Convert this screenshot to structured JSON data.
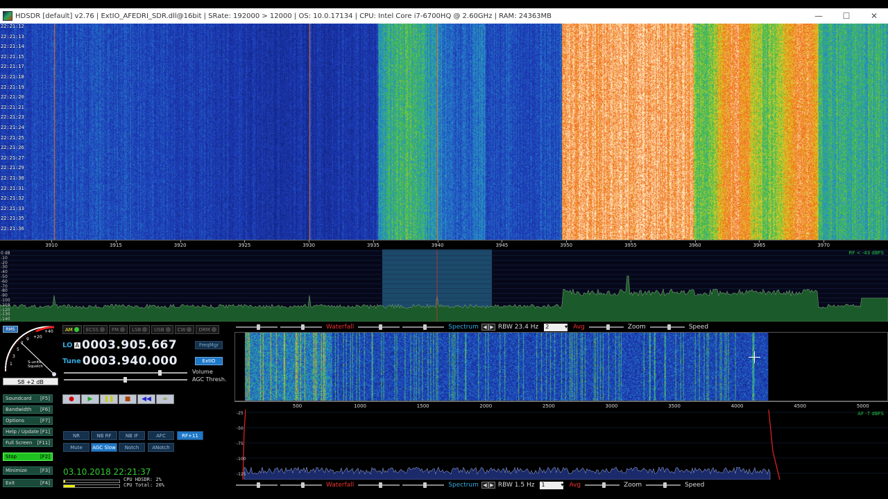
{
  "window": {
    "title": "HDSDR  [default]  v2.76  |  ExtIO_AFEDRI_SDR.dll@16bit  |  SRate: 192000 > 12000  |  OS: 10.0.17134  |  CPU: Intel Core i7-6700HQ @ 2.60GHz  |  RAM: 24363MB",
    "buttons": {
      "minimize": "—",
      "maximize": "☐",
      "close": "✕"
    }
  },
  "waterfall_times": [
    "22:21:12",
    "22:21:13",
    "22:21:14",
    "22:21:15",
    "22:21:17",
    "22:21:18",
    "22:21:19",
    "22:21:20",
    "22:21:21",
    "22:21:23",
    "22:21:24",
    "22:21:25",
    "22:21:26",
    "22:21:27",
    "22:21:29",
    "22:21:30",
    "22:21:31",
    "22:21:32",
    "22:21:33",
    "22:21:35",
    "22:21:36"
  ],
  "rf_axis": {
    "ticks": [
      "3910",
      "3915",
      "3920",
      "3925",
      "3930",
      "3935",
      "3940",
      "3945",
      "3950",
      "3955",
      "3960",
      "3965",
      "3970"
    ],
    "min": 3906,
    "max": 3975
  },
  "rf_db_labels": [
    "0 dB",
    "-10",
    "-20",
    "-30",
    "-40",
    "-50",
    "-60",
    "-70",
    "-80",
    "-90",
    "-100",
    "-110",
    "-120",
    "-130",
    "-140"
  ],
  "rf_level": "RF < -43 dBFS",
  "af_level": "AF -7 dBFS",
  "top_controls": {
    "waterfall": "Waterfall",
    "spectrum": "Spectrum",
    "rbw": "RBW 23.4 Hz",
    "avg_value": "2",
    "avg": "Avg",
    "zoom": "Zoom",
    "speed": "Speed"
  },
  "bottom_controls": {
    "waterfall": "Waterfall",
    "spectrum": "Spectrum",
    "rbw": "RBW  1.5 Hz",
    "avg_value": "1",
    "avg": "Avg",
    "zoom": "Zoom",
    "speed": "Speed"
  },
  "af_axis": {
    "ticks": [
      "500",
      "1000",
      "1500",
      "2000",
      "2500",
      "3000",
      "3500",
      "4000",
      "4500",
      "5000"
    ],
    "max": 5200
  },
  "af_db_labels": [
    "-25",
    "-50",
    "-75",
    "-100",
    "-125"
  ],
  "smeter": {
    "rms": "RMS",
    "readout": "S8 +2 dB",
    "scale": [
      "1",
      "3",
      "5",
      "7",
      "9",
      "+20",
      "+40"
    ],
    "label1": "S-units",
    "label2": "Squelch"
  },
  "modes": [
    "AM",
    "ECSS",
    "FM",
    "LSB",
    "USB",
    "CW",
    "DRM"
  ],
  "lo": {
    "label": "LO",
    "ab": "A",
    "value": "0003.905.667"
  },
  "tune": {
    "label": "Tune",
    "value": "0003.940.000"
  },
  "freqmgr": "FreqMgr",
  "extio": "ExtIO",
  "volume": "Volume",
  "agc_thresh": "AGC Thresh.",
  "left_buttons": [
    {
      "label": "Soundcard",
      "key": "[F5]"
    },
    {
      "label": "Bandwidth",
      "key": "[F6]"
    },
    {
      "label": "Options",
      "key": "[F7]"
    },
    {
      "label": "Help / Update",
      "key": "[F1]"
    },
    {
      "label": "Full Screen",
      "key": "[F11]"
    },
    {
      "label": "Stop",
      "key": "[F2]"
    },
    {
      "label": "Minimize",
      "key": "[F3]"
    },
    {
      "label": "Exit",
      "key": "[F4]"
    }
  ],
  "dsp_row1": [
    "NR",
    "NB RF",
    "NB IF",
    "AFC",
    "RF+11"
  ],
  "dsp_row2": [
    "Mute",
    "AGC Slow",
    "Notch",
    "ANotch"
  ],
  "clock": "03.10.2018 22:21:37",
  "cpu": {
    "hdsdr": "CPU HDSDR:  2%",
    "total": "CPU Total: 20%",
    "hdsdr_level": 0.02,
    "total_level": 0.2
  }
}
